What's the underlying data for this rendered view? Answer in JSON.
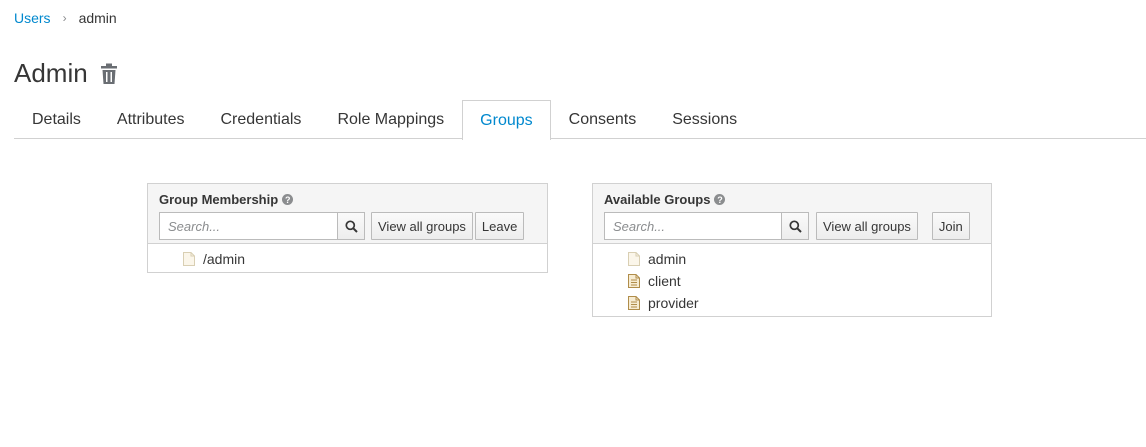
{
  "breadcrumb": {
    "parent": "Users",
    "current": "admin"
  },
  "page": {
    "title": "Admin"
  },
  "tabs": [
    {
      "label": "Details"
    },
    {
      "label": "Attributes"
    },
    {
      "label": "Credentials"
    },
    {
      "label": "Role Mappings"
    },
    {
      "label": "Groups"
    },
    {
      "label": "Consents"
    },
    {
      "label": "Sessions"
    }
  ],
  "active_tab": "Groups",
  "membership": {
    "title": "Group Membership",
    "search_placeholder": "Search...",
    "view_all_label": "View all groups",
    "action_label": "Leave",
    "items": [
      {
        "label": "/admin"
      }
    ]
  },
  "available": {
    "title": "Available Groups",
    "search_placeholder": "Search...",
    "view_all_label": "View all groups",
    "action_label": "Join",
    "items": [
      {
        "label": "admin"
      },
      {
        "label": "client"
      },
      {
        "label": "provider"
      }
    ]
  },
  "colors": {
    "link": "#0088ce",
    "text": "#363636",
    "border": "#d1d1d1",
    "panel_header": "#f5f5f5"
  },
  "icons": {
    "delete": "trash-icon",
    "help": "question-circle-icon",
    "search": "search-icon",
    "tree_item": "file-icon"
  }
}
